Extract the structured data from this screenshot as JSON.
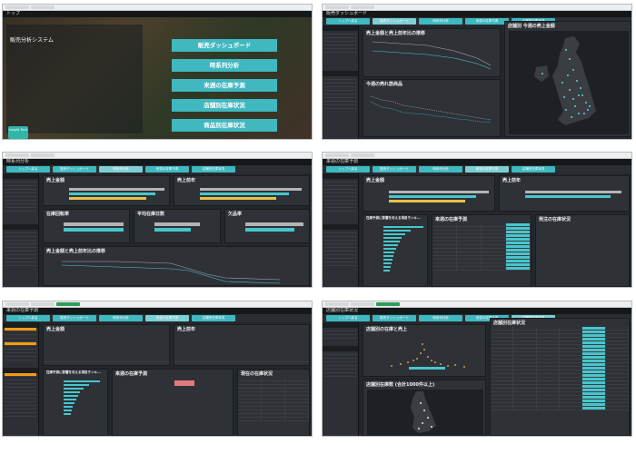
{
  "top": {
    "window_title": "トップ",
    "system_title": "販売分析システム",
    "menu": [
      "販売ダッシュボード",
      "時系列分析",
      "来週の在庫予測",
      "店舗別在庫状況",
      "商品別在庫状況"
    ],
    "logo_text": "Insight Tech"
  },
  "dashboard": {
    "window_title": "販売ダッシュボード",
    "chart1_title": "売上金額と売上前年比の推移",
    "chart2_title": "今週の売れ筋商品",
    "map_title": "店舗別 今週の売上金額"
  },
  "timeseries": {
    "window_title": "時系列分析",
    "card1": "売上金額",
    "card2": "売上前年",
    "card3": "在庫回転率",
    "card4": "平均在庫日数",
    "card5": "欠品率",
    "card6": "売上金額と売上前年比の推移"
  },
  "forecast": {
    "window_title": "来週の在庫予測",
    "card1": "売上金額",
    "card2": "売上前年",
    "list1": "在庫予測に影響を与える項目ランキ...",
    "list2": "来週の在庫予測",
    "list3": "発注の在庫状況"
  },
  "store_stock": {
    "window_title": "来週の在庫予測",
    "card1": "売上金額",
    "card2": "売上前年",
    "list1": "在庫予測に影響を与える項目ランキ...",
    "list2": "来週の在庫予測",
    "list3": "現在の在庫状況"
  },
  "product_stock": {
    "window_title": "店舗別在庫状況",
    "chart1_title": "店舗別の在庫と売上",
    "map_title": "店舗別在庫数 (合計1000件以上)",
    "table_title": "店舗別在庫状況"
  },
  "nav": [
    "トップへ戻る",
    "販売ダッシュボード",
    "時系列分析",
    "来週の在庫予測",
    "店舗別在庫状況"
  ]
}
